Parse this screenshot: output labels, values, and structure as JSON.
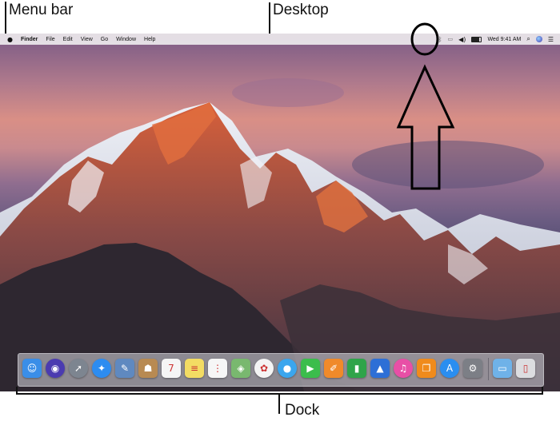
{
  "labels": {
    "menu_bar": "Menu bar",
    "desktop": "Desktop",
    "dock": "Dock"
  },
  "menubar": {
    "apple_icon": "apple-logo-icon",
    "app_name": "Finder",
    "menus": [
      "File",
      "Edit",
      "View",
      "Go",
      "Window",
      "Help"
    ],
    "clock": "Wed 9:41 AM",
    "status_icons": [
      "bluetooth-icon",
      "airplay-icon",
      "volume-icon",
      "battery-icon",
      "spotlight-search-icon",
      "siri-icon",
      "notification-center-icon"
    ]
  },
  "dock": {
    "apps": [
      {
        "name": "finder-icon",
        "glyph": "☺",
        "color": "#3a8ee8"
      },
      {
        "name": "siri-icon",
        "glyph": "◉",
        "color": "#4b3bb0"
      },
      {
        "name": "launchpad-icon",
        "glyph": "➚",
        "color": "#7d8590"
      },
      {
        "name": "safari-icon",
        "glyph": "✦",
        "color": "#2d8cf0"
      },
      {
        "name": "photo-browser-icon",
        "glyph": "✎",
        "color": "#5f89c0"
      },
      {
        "name": "contacts-icon",
        "glyph": "☗",
        "color": "#b88a52"
      },
      {
        "name": "calendar-icon",
        "glyph": "7",
        "color": "#f5f5f5"
      },
      {
        "name": "notes-icon",
        "glyph": "≡",
        "color": "#f3dc63"
      },
      {
        "name": "reminders-icon",
        "glyph": "⋮",
        "color": "#f6f6f6"
      },
      {
        "name": "maps-icon",
        "glyph": "◈",
        "color": "#79b86f"
      },
      {
        "name": "photos-icon",
        "glyph": "✿",
        "color": "#f4f4f4"
      },
      {
        "name": "messages-icon",
        "glyph": "●",
        "color": "#3aa6ee"
      },
      {
        "name": "facetime-icon",
        "glyph": "▶",
        "color": "#3bbd4c"
      },
      {
        "name": "pages-icon",
        "glyph": "✐",
        "color": "#f08a2a"
      },
      {
        "name": "numbers-icon",
        "glyph": "▮",
        "color": "#2fa44a"
      },
      {
        "name": "keynote-icon",
        "glyph": "▲",
        "color": "#2d6fd6"
      },
      {
        "name": "itunes-icon",
        "glyph": "♫",
        "color": "#e84fa6"
      },
      {
        "name": "ibooks-icon",
        "glyph": "❐",
        "color": "#f08b1c"
      },
      {
        "name": "app-store-icon",
        "glyph": "A",
        "color": "#2a8ef0"
      },
      {
        "name": "system-preferences-icon",
        "glyph": "⚙",
        "color": "#7c7f86"
      },
      {
        "name": "downloads-folder-icon",
        "glyph": "▭",
        "color": "#6fb2e8"
      },
      {
        "name": "trash-icon",
        "glyph": "▯",
        "color": "#dcdde0"
      }
    ]
  },
  "annotation": {
    "highlight": "circle-around-bluetooth-icon",
    "pointer": "up-arrow-icon"
  }
}
